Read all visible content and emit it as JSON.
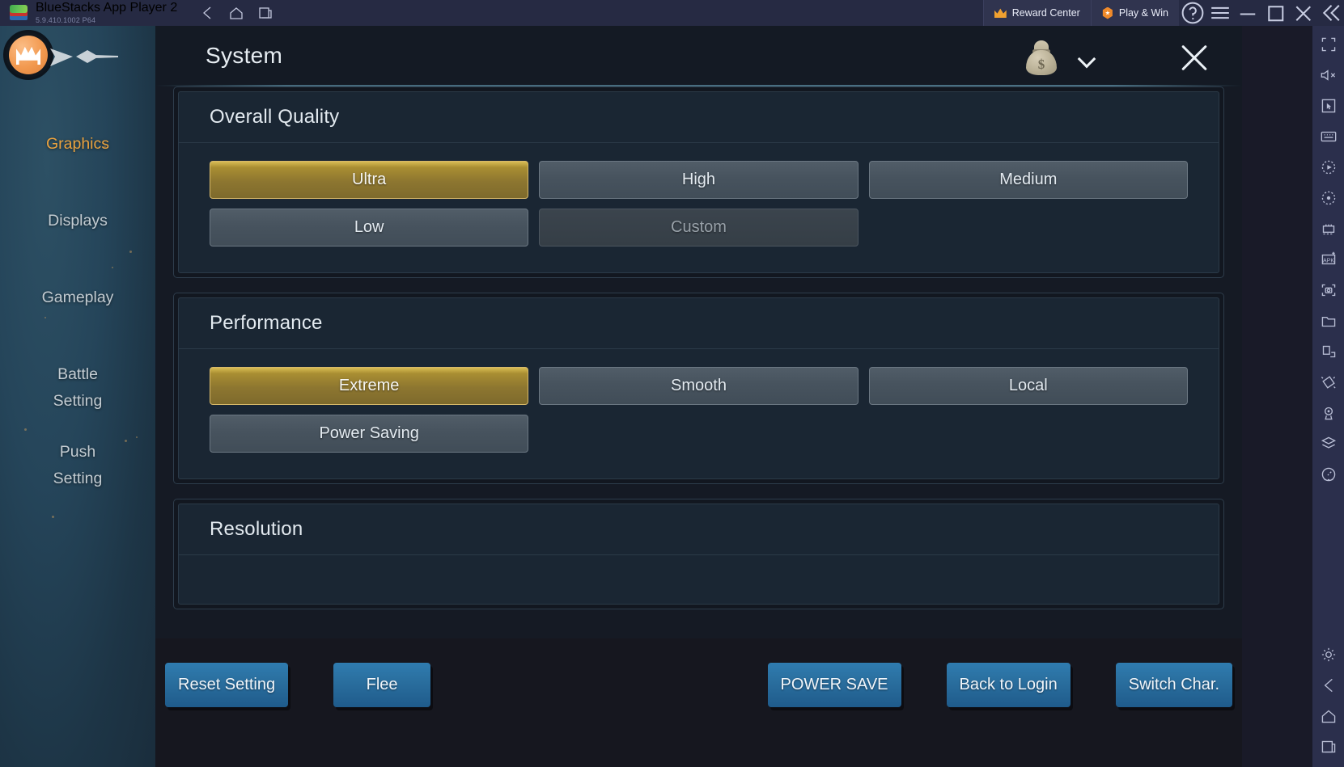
{
  "bluestacks": {
    "title": "BlueStacks App Player 2",
    "version": "5.9.410.1002  P64",
    "nav": [
      {
        "name": "back-icon",
        "label": "Back"
      },
      {
        "name": "home-icon",
        "label": "Home"
      },
      {
        "name": "multi-instance-icon",
        "label": "Instances"
      }
    ],
    "reward_center": "Reward Center",
    "play_and_win": "Play & Win",
    "window_controls": [
      "help",
      "menu",
      "minimize",
      "maximize",
      "close",
      "collapse"
    ],
    "sidebar_icons": [
      "fullscreen-icon",
      "mute-icon",
      "pointer-icon",
      "keyboard-icon",
      "macro-play-icon",
      "record-icon",
      "multi-instance-manager-icon",
      "install-apk-icon",
      "screenshot-icon",
      "media-folder-icon",
      "rotate-layout-icon",
      "shake-icon",
      "location-icon",
      "layers-icon",
      "gamepad-icon"
    ],
    "sidebar_bottom_icons": [
      "settings-icon",
      "back-icon",
      "home-icon",
      "recents-icon"
    ]
  },
  "game": {
    "header": {
      "title": "System",
      "currency_icon": "money-bag-icon",
      "dropdown_icon": "chevron-down-icon",
      "close_icon": "close-icon"
    },
    "sidebar": {
      "logo": "crown-emblem-icon",
      "items": [
        {
          "label": "Graphics",
          "active": true
        },
        {
          "label": "Displays",
          "active": false
        },
        {
          "label": "Gameplay",
          "active": false
        },
        {
          "label": "Battle\nSetting",
          "line1": "Battle",
          "line2": "Setting",
          "active": false
        },
        {
          "label": "Push\nSetting",
          "line1": "Push",
          "line2": "Setting",
          "active": false
        }
      ]
    },
    "sections": [
      {
        "title": "Overall Quality",
        "rows": [
          [
            {
              "label": "Ultra",
              "state": "selected"
            },
            {
              "label": "High",
              "state": "normal"
            },
            {
              "label": "Medium",
              "state": "normal"
            }
          ],
          [
            {
              "label": "Low",
              "state": "normal"
            },
            {
              "label": "Custom",
              "state": "disabled"
            },
            {
              "label": "",
              "state": "ghost"
            }
          ]
        ]
      },
      {
        "title": "Performance",
        "rows": [
          [
            {
              "label": "Extreme",
              "state": "selected"
            },
            {
              "label": "Smooth",
              "state": "normal"
            },
            {
              "label": "Local",
              "state": "normal"
            }
          ],
          [
            {
              "label": "Power Saving",
              "state": "normal"
            },
            {
              "label": "",
              "state": "ghost"
            },
            {
              "label": "",
              "state": "ghost"
            }
          ]
        ]
      },
      {
        "title": "Resolution",
        "rows": []
      }
    ],
    "footer": {
      "left_buttons": [
        {
          "label": "Reset Setting"
        },
        {
          "label": "Flee"
        }
      ],
      "right_buttons": [
        {
          "label": "POWER SAVE"
        },
        {
          "label": "Back to Login"
        },
        {
          "label": "Switch Char."
        }
      ]
    }
  },
  "colors": {
    "accent_gold": "#d8bc54",
    "nav_active": "#e9a23f",
    "button_blue": "#2f7cb0",
    "panel_bg": "#1a2633",
    "bluestacks_bar": "#262a43"
  }
}
